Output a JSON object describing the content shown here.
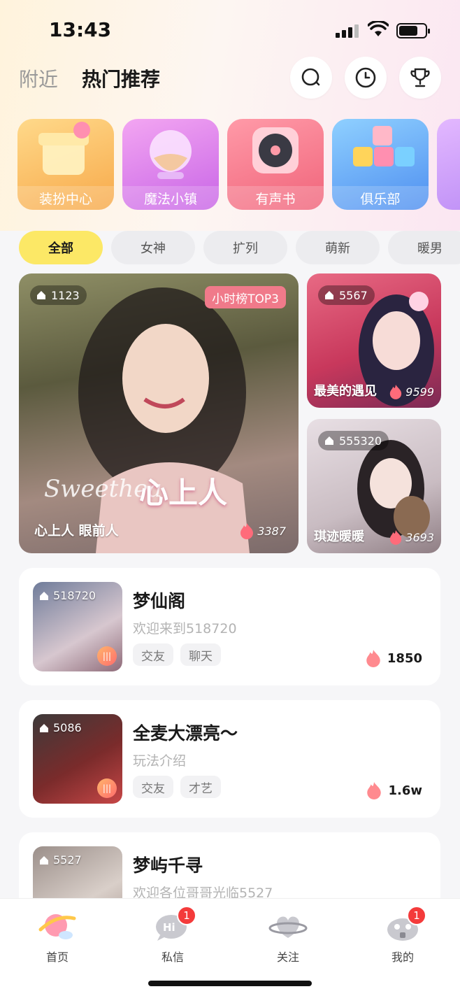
{
  "status_bar": {
    "time": "13:43"
  },
  "header": {
    "tabs": [
      {
        "label": "附近",
        "active": false
      },
      {
        "label": "热门推荐",
        "active": true
      }
    ]
  },
  "features": [
    {
      "label": "装扮中心",
      "color": "#f7b24b"
    },
    {
      "label": "魔法小镇",
      "color": "#d872e9"
    },
    {
      "label": "有声书",
      "color": "#f46a84"
    },
    {
      "label": "俱乐部",
      "color": "#5aa2f5"
    }
  ],
  "filters": [
    "全部",
    "女神",
    "扩列",
    "萌新",
    "暖男"
  ],
  "featured": {
    "main": {
      "id": "1123",
      "badge": "小时榜TOP3",
      "title": "心上人  眼前人",
      "heat": "3387",
      "overlay": "心上人",
      "script": "Sweethea"
    },
    "side": [
      {
        "id": "5567",
        "title": "最美的遇见",
        "heat": "9599"
      },
      {
        "id": "555320",
        "title": "琪迹暖暖",
        "heat": "3693"
      }
    ]
  },
  "rooms": [
    {
      "id": "518720",
      "name": "梦仙阁",
      "desc": "欢迎来到518720",
      "tags": [
        "交友",
        "聊天"
      ],
      "heat": "1850"
    },
    {
      "id": "5086",
      "name": "全麦大漂亮～",
      "desc": "玩法介绍",
      "tags": [
        "交友",
        "才艺"
      ],
      "heat": "1.6w"
    },
    {
      "id": "5527",
      "name": "梦屿千寻",
      "desc": "欢迎各位哥哥光临5527",
      "tags": [],
      "heat": ""
    }
  ],
  "tabbar": [
    {
      "label": "首页",
      "badge": ""
    },
    {
      "label": "私信",
      "badge": "1"
    },
    {
      "label": "关注",
      "badge": ""
    },
    {
      "label": "我的",
      "badge": "1"
    }
  ],
  "colors": {
    "accent": "#fce866",
    "badge_red": "#f43b3b"
  }
}
